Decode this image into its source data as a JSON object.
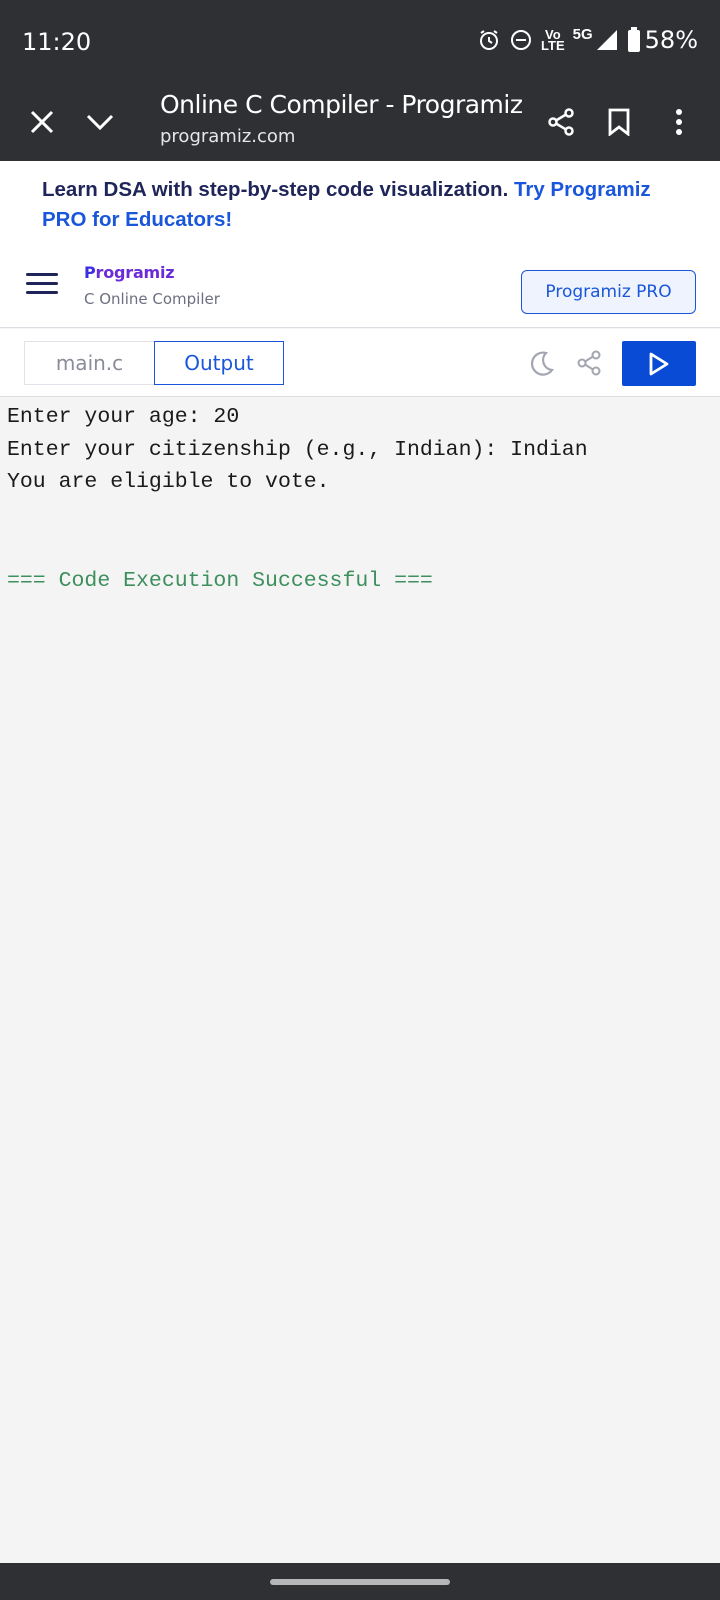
{
  "status_bar": {
    "time": "11:20",
    "network_label_top": "Vo",
    "network_label_bottom": "LTE",
    "network_type": "5G",
    "battery": "58%",
    "icons": [
      "alarm-icon",
      "dnd-icon",
      "volte-icon",
      "signal-icon",
      "battery-icon"
    ]
  },
  "browser": {
    "title": "Online C Compiler - Programiz",
    "domain": "programiz.com",
    "icons": [
      "close-icon",
      "chevron-down-icon",
      "share-icon",
      "bookmark-icon",
      "more-vert-icon"
    ]
  },
  "promo": {
    "text": "Learn DSA with step-by-step code visualization. ",
    "link": "Try Programiz PRO for Educators!"
  },
  "site_nav": {
    "logo_first": "P",
    "logo_rest": "rogramiz",
    "subtitle": "C Online Compiler",
    "pro_button": "Programiz PRO"
  },
  "toolbar": {
    "file_tab": "main.c",
    "output_tab": "Output",
    "icons": [
      "moon-icon",
      "share-icon",
      "play-icon"
    ]
  },
  "output": {
    "lines": [
      "Enter your age: 20",
      "Enter your citizenship (e.g., Indian): Indian",
      "You are eligible to vote."
    ],
    "status": "=== Code Execution Successful ==="
  },
  "colors": {
    "accent": "#1a56db",
    "run_button": "#0a4bd6",
    "chrome_bg": "#2e3034",
    "success": "#3d8f5e",
    "heading": "#1f2559"
  }
}
